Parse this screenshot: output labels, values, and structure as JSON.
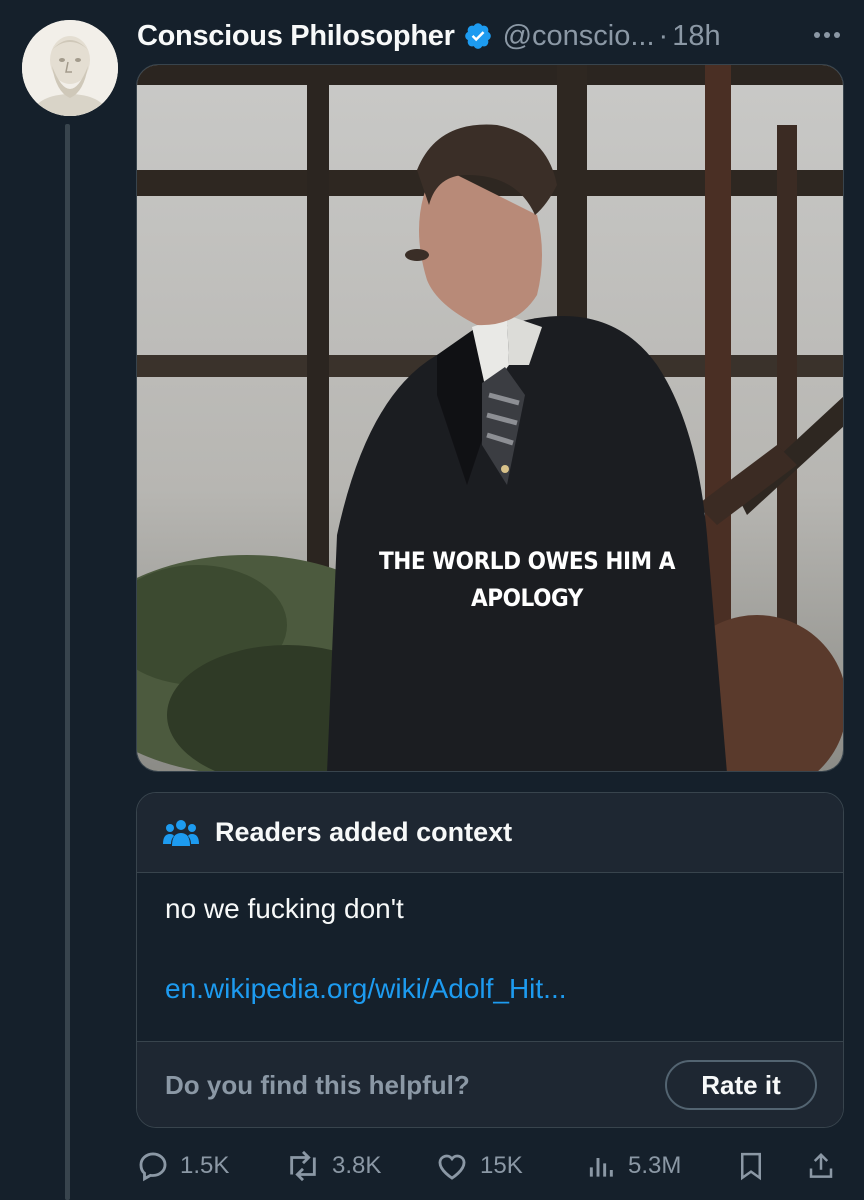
{
  "post": {
    "author_name": "Conscious Philosopher",
    "handle": "@conscio...",
    "separator": "·",
    "time": "18h",
    "avatar_icon": "socrates-bust-avatar",
    "media_overlay_line1": "THE WORLD OWES HIM A",
    "media_overlay_line2": "APOLOGY"
  },
  "community_note": {
    "title": "Readers added context",
    "text": "no we fucking don't",
    "link": "en.wikipedia.org/wiki/Adolf_Hit...",
    "helpful_prompt": "Do you find this helpful?",
    "rate_label": "Rate it"
  },
  "actions": {
    "replies": "1.5K",
    "reposts": "3.8K",
    "likes": "15K",
    "views": "5.3M"
  },
  "colors": {
    "background": "#15202b",
    "link": "#1d9bf0",
    "muted": "#8b98a5",
    "verified": "#1d9bf0"
  }
}
